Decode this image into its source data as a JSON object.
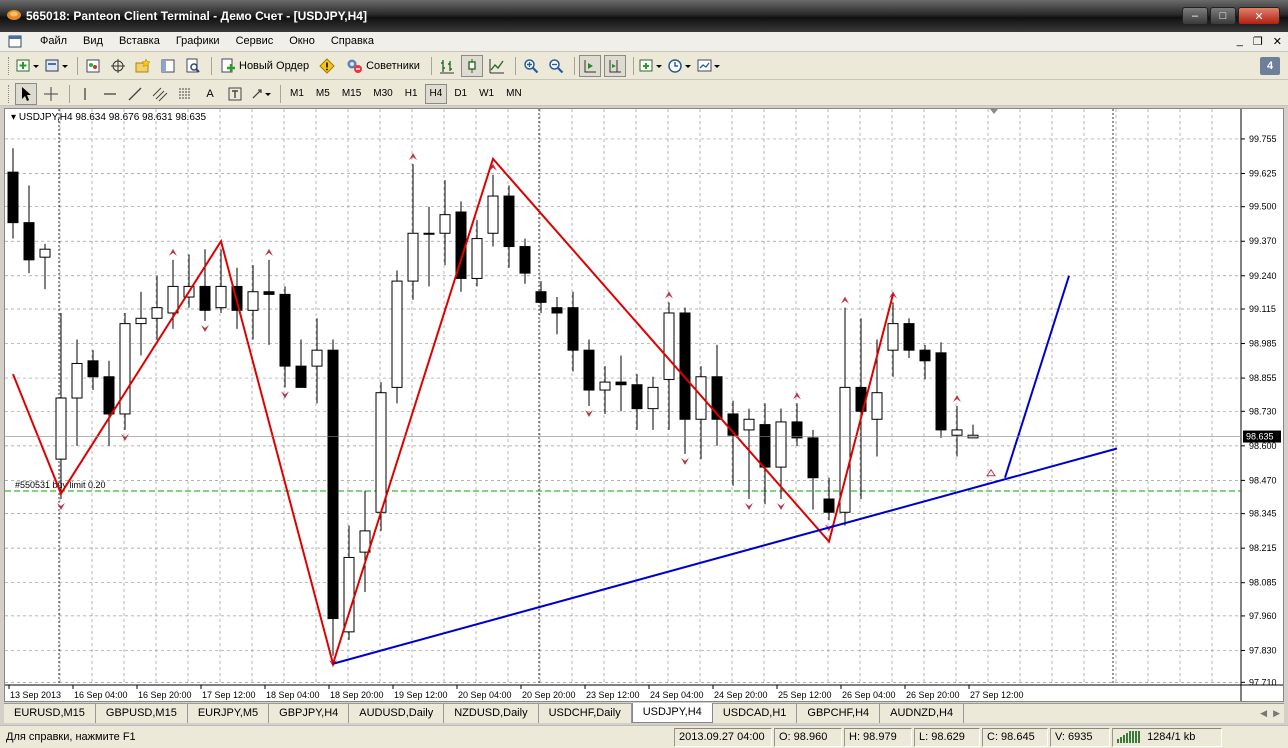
{
  "window": {
    "title": "565018: Panteon Client Terminal - Демо Счет - [USDJPY,H4]",
    "minimize_label": "–",
    "maximize_label": "□",
    "close_label": "✕"
  },
  "menu": {
    "items": [
      "Файл",
      "Вид",
      "Вставка",
      "Графики",
      "Сервис",
      "Окно",
      "Справка"
    ],
    "mdi_minimize": "_",
    "mdi_restore": "❐",
    "mdi_close": "✕"
  },
  "toolbar": {
    "new_order_label": "Новый Ордер",
    "experts_label": "Советники",
    "timeframes": [
      "M1",
      "M5",
      "M15",
      "M30",
      "H1",
      "H4",
      "D1",
      "W1",
      "MN"
    ],
    "active_timeframe": "H4",
    "text_tool_label": "A",
    "help_label": "4"
  },
  "chart": {
    "info_symbol": "USDJPY,H4",
    "info_ohlc": "98.634 98.676 98.631 98.635",
    "order_label": "#550531 buy limit 0.20",
    "current_price": "98.635"
  },
  "chart_data": {
    "type": "candlestick",
    "symbol": "USDJPY",
    "timeframe": "H4",
    "y_ticks": [
      "99.755",
      "99.625",
      "99.500",
      "99.370",
      "99.240",
      "99.115",
      "98.985",
      "98.855",
      "98.730",
      "98.600",
      "98.470",
      "98.345",
      "98.215",
      "98.085",
      "97.960",
      "97.830",
      "97.710"
    ],
    "ylim": [
      97.7,
      99.83
    ],
    "x_ticks": [
      "13 Sep 2013",
      "16 Sep 04:00",
      "16 Sep 20:00",
      "17 Sep 12:00",
      "18 Sep 04:00",
      "18 Sep 20:00",
      "19 Sep 12:00",
      "20 Sep 04:00",
      "20 Sep 20:00",
      "23 Sep 12:00",
      "24 Sep 04:00",
      "24 Sep 20:00",
      "25 Sep 12:00",
      "26 Sep 04:00",
      "26 Sep 20:00",
      "27 Sep 12:00"
    ],
    "candles": [
      {
        "o": 99.63,
        "h": 99.72,
        "l": 99.38,
        "c": 99.44
      },
      {
        "o": 99.44,
        "h": 99.58,
        "l": 99.25,
        "c": 99.3
      },
      {
        "o": 99.31,
        "h": 99.36,
        "l": 99.19,
        "c": 99.34
      },
      {
        "o": 98.55,
        "h": 99.1,
        "l": 98.4,
        "c": 98.78
      },
      {
        "o": 98.78,
        "h": 99.0,
        "l": 98.6,
        "c": 98.91
      },
      {
        "o": 98.92,
        "h": 98.96,
        "l": 98.81,
        "c": 98.86
      },
      {
        "o": 98.86,
        "h": 98.92,
        "l": 98.6,
        "c": 98.72
      },
      {
        "o": 98.72,
        "h": 99.1,
        "l": 98.66,
        "c": 99.06
      },
      {
        "o": 99.06,
        "h": 99.18,
        "l": 98.94,
        "c": 99.08
      },
      {
        "o": 99.08,
        "h": 99.24,
        "l": 99.0,
        "c": 99.12
      },
      {
        "o": 99.1,
        "h": 99.3,
        "l": 99.04,
        "c": 99.2
      },
      {
        "o": 99.16,
        "h": 99.32,
        "l": 99.12,
        "c": 99.2
      },
      {
        "o": 99.2,
        "h": 99.34,
        "l": 99.07,
        "c": 99.11
      },
      {
        "o": 99.12,
        "h": 99.34,
        "l": 99.1,
        "c": 99.2
      },
      {
        "o": 99.2,
        "h": 99.27,
        "l": 99.04,
        "c": 99.11
      },
      {
        "o": 99.11,
        "h": 99.28,
        "l": 99.0,
        "c": 99.18
      },
      {
        "o": 99.18,
        "h": 99.3,
        "l": 98.98,
        "c": 99.17
      },
      {
        "o": 99.17,
        "h": 99.2,
        "l": 98.82,
        "c": 98.9
      },
      {
        "o": 98.9,
        "h": 99.0,
        "l": 98.83,
        "c": 98.82
      },
      {
        "o": 98.9,
        "h": 99.08,
        "l": 98.76,
        "c": 98.96
      },
      {
        "o": 98.96,
        "h": 99.0,
        "l": 97.81,
        "c": 97.95
      },
      {
        "o": 97.9,
        "h": 98.3,
        "l": 97.87,
        "c": 98.18
      },
      {
        "o": 98.2,
        "h": 98.43,
        "l": 98.05,
        "c": 98.28
      },
      {
        "o": 98.35,
        "h": 98.84,
        "l": 98.28,
        "c": 98.8
      },
      {
        "o": 98.82,
        "h": 99.26,
        "l": 98.76,
        "c": 99.22
      },
      {
        "o": 99.22,
        "h": 99.66,
        "l": 99.15,
        "c": 99.4
      },
      {
        "o": 99.4,
        "h": 99.5,
        "l": 99.2,
        "c": 99.4
      },
      {
        "o": 99.4,
        "h": 99.6,
        "l": 99.28,
        "c": 99.47
      },
      {
        "o": 99.48,
        "h": 99.52,
        "l": 99.18,
        "c": 99.23
      },
      {
        "o": 99.23,
        "h": 99.45,
        "l": 99.2,
        "c": 99.38
      },
      {
        "o": 99.4,
        "h": 99.62,
        "l": 99.35,
        "c": 99.54
      },
      {
        "o": 99.54,
        "h": 99.58,
        "l": 99.27,
        "c": 99.35
      },
      {
        "o": 99.35,
        "h": 99.38,
        "l": 99.21,
        "c": 99.25
      },
      {
        "o": 99.18,
        "h": 99.22,
        "l": 99.1,
        "c": 99.14
      },
      {
        "o": 99.12,
        "h": 99.16,
        "l": 99.02,
        "c": 99.1
      },
      {
        "o": 99.12,
        "h": 99.18,
        "l": 98.88,
        "c": 98.96
      },
      {
        "o": 98.96,
        "h": 99.0,
        "l": 98.75,
        "c": 98.81
      },
      {
        "o": 98.81,
        "h": 98.9,
        "l": 98.72,
        "c": 98.84
      },
      {
        "o": 98.84,
        "h": 98.94,
        "l": 98.73,
        "c": 98.83
      },
      {
        "o": 98.83,
        "h": 98.87,
        "l": 98.66,
        "c": 98.74
      },
      {
        "o": 98.74,
        "h": 98.86,
        "l": 98.66,
        "c": 98.82
      },
      {
        "o": 98.85,
        "h": 99.14,
        "l": 98.66,
        "c": 99.1
      },
      {
        "o": 99.1,
        "h": 99.12,
        "l": 98.57,
        "c": 98.7
      },
      {
        "o": 98.7,
        "h": 98.9,
        "l": 98.55,
        "c": 98.86
      },
      {
        "o": 98.86,
        "h": 98.98,
        "l": 98.6,
        "c": 98.7
      },
      {
        "o": 98.72,
        "h": 98.77,
        "l": 98.45,
        "c": 98.64
      },
      {
        "o": 98.66,
        "h": 98.74,
        "l": 98.4,
        "c": 98.7
      },
      {
        "o": 98.68,
        "h": 98.76,
        "l": 98.38,
        "c": 98.52
      },
      {
        "o": 98.52,
        "h": 98.74,
        "l": 98.4,
        "c": 98.69
      },
      {
        "o": 98.69,
        "h": 98.76,
        "l": 98.6,
        "c": 98.63
      },
      {
        "o": 98.63,
        "h": 98.66,
        "l": 98.36,
        "c": 98.48
      },
      {
        "o": 98.4,
        "h": 98.48,
        "l": 98.32,
        "c": 98.35
      },
      {
        "o": 98.35,
        "h": 99.12,
        "l": 98.3,
        "c": 98.82
      },
      {
        "o": 98.82,
        "h": 99.08,
        "l": 98.4,
        "c": 98.73
      },
      {
        "o": 98.7,
        "h": 99.0,
        "l": 98.56,
        "c": 98.8
      },
      {
        "o": 98.96,
        "h": 99.14,
        "l": 98.86,
        "c": 99.06
      },
      {
        "o": 99.06,
        "h": 99.08,
        "l": 98.93,
        "c": 98.96
      },
      {
        "o": 98.96,
        "h": 98.98,
        "l": 98.85,
        "c": 98.92
      },
      {
        "o": 98.95,
        "h": 98.99,
        "l": 98.63,
        "c": 98.66
      },
      {
        "o": 98.64,
        "h": 98.75,
        "l": 98.56,
        "c": 98.66
      },
      {
        "o": 98.63,
        "h": 98.68,
        "l": 98.63,
        "c": 98.64
      }
    ],
    "zigzag": [
      {
        "i": 0,
        "price": 98.87
      },
      {
        "i": 3,
        "price": 98.42
      },
      {
        "i": 13,
        "price": 99.37
      },
      {
        "i": 20,
        "price": 97.78
      },
      {
        "i": 30,
        "price": 99.68
      },
      {
        "i": 51,
        "price": 98.24
      },
      {
        "i": 55,
        "price": 99.17
      }
    ],
    "trendline": [
      {
        "i": 20,
        "price": 97.78
      },
      {
        "i": 69,
        "price": 98.59
      }
    ],
    "projection": [
      {
        "i": 62,
        "price": 98.48
      },
      {
        "i": 66,
        "price": 99.24
      }
    ],
    "fractals_up": [
      25,
      30,
      10,
      16,
      41,
      49,
      52,
      55,
      59
    ],
    "fractals_down": [
      3,
      7,
      12,
      17,
      20,
      36,
      42,
      48,
      51,
      46
    ],
    "order_line_price": 98.43,
    "current_price": 98.635
  },
  "tabs": {
    "items": [
      "EURUSD,M15",
      "GBPUSD,M15",
      "EURJPY,M5",
      "GBPJPY,H4",
      "AUDUSD,Daily",
      "NZDUSD,Daily",
      "USDCHF,Daily",
      "USDJPY,H4",
      "USDCAD,H1",
      "GBPCHF,H4",
      "AUDNZD,H4"
    ],
    "active": "USDJPY,H4"
  },
  "status": {
    "help": "Для справки, нажмите F1",
    "datetime": "2013.09.27 04:00",
    "open": "O: 98.960",
    "high": "H: 98.979",
    "low": "L: 98.629",
    "close": "C: 98.645",
    "volume": "V: 6935",
    "traffic": "1284/1 kb"
  },
  "colors": {
    "zigzag": "#e00000",
    "trendline": "#0000cc",
    "order_line": "#00aa00",
    "fractal": "#c03050",
    "grid": "#999999"
  }
}
